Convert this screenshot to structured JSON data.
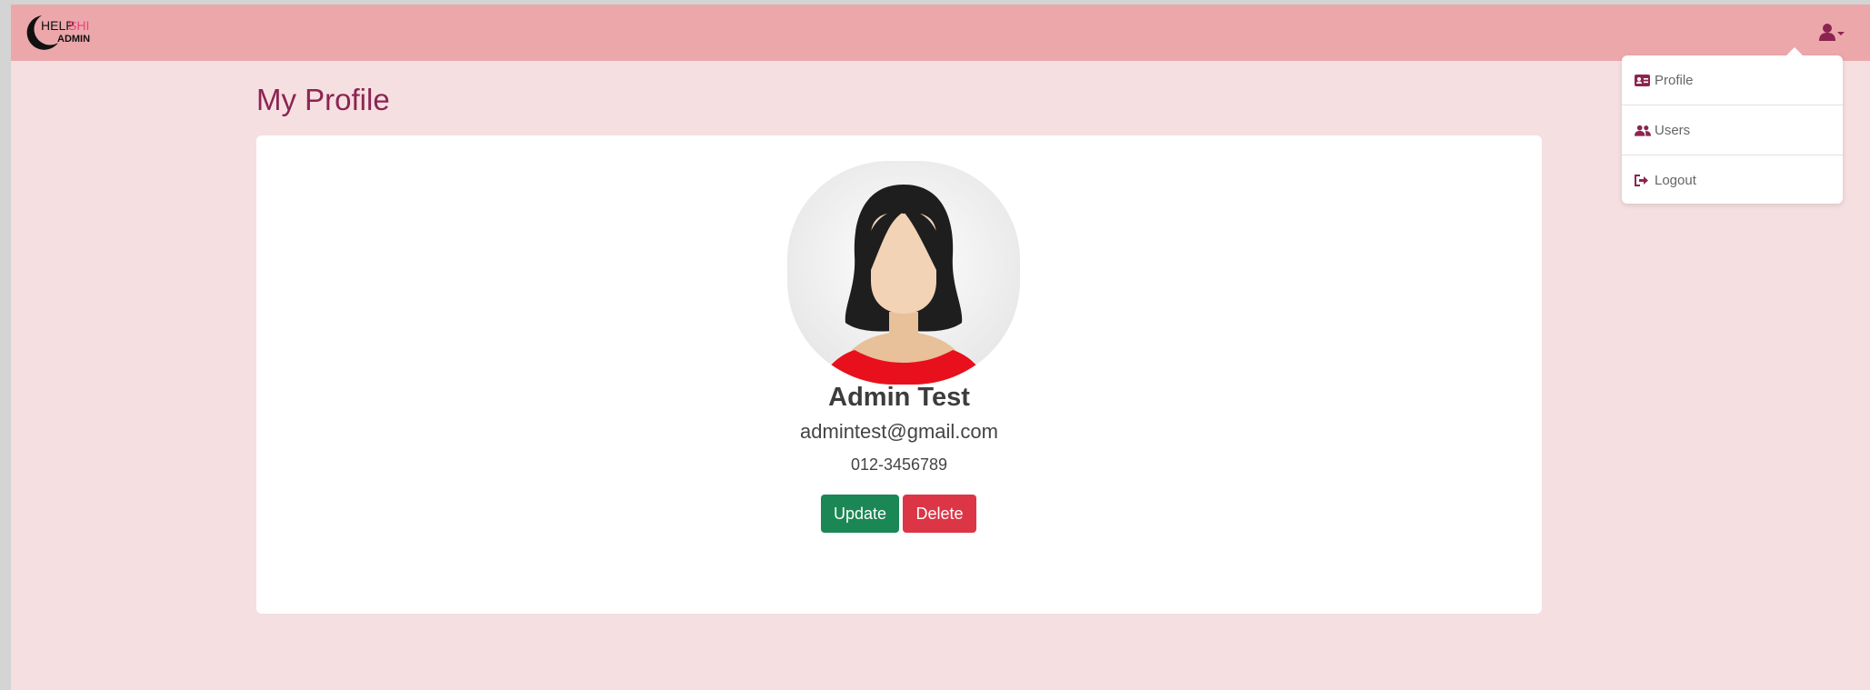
{
  "brand": {
    "logo_text_1": "HELP",
    "logo_text_2": "SHI",
    "logo_text_3": "ADMIN"
  },
  "header": {
    "user_menu_icon": "user-icon",
    "accent_color": "#8c2451"
  },
  "dropdown": {
    "items": [
      {
        "label": "Profile",
        "icon": "id-card-icon"
      },
      {
        "label": "Users",
        "icon": "users-icon"
      },
      {
        "label": "Logout",
        "icon": "logout-icon"
      }
    ]
  },
  "page": {
    "title": "My Profile"
  },
  "profile": {
    "name": "Admin Test",
    "email": "admintest@gmail.com",
    "phone": "012-3456789",
    "avatar_icon": "female-avatar"
  },
  "actions": {
    "update_label": "Update",
    "delete_label": "Delete",
    "update_color": "#1a8754",
    "delete_color": "#dc3546"
  },
  "colors": {
    "navbar": "#eca7ab",
    "page_background": "#f5dfe1"
  }
}
